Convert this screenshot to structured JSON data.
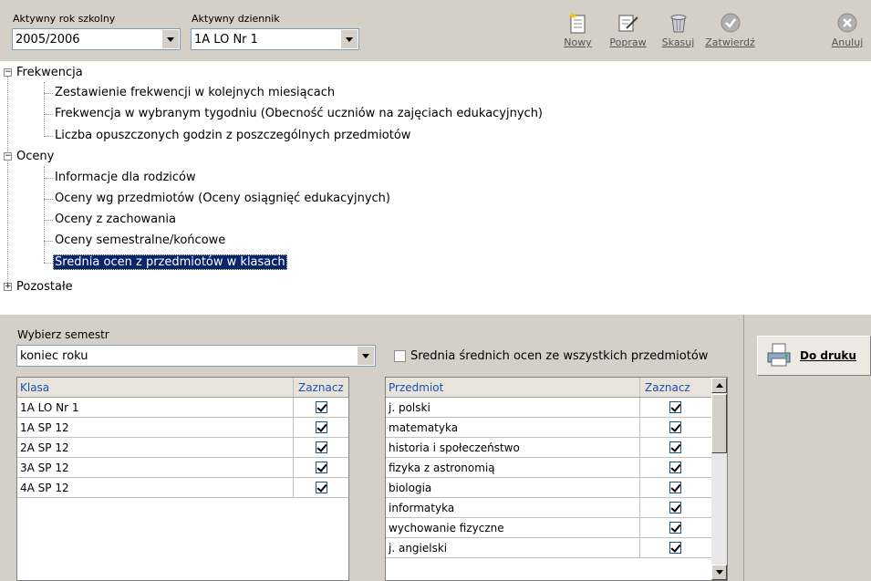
{
  "toolbar": {
    "year_label": "Aktywny rok szkolny",
    "year_value": "2005/2006",
    "journal_label": "Aktywny dziennik",
    "journal_value": "1A  LO Nr 1",
    "buttons": [
      {
        "label": "Nowy",
        "icon": "new-document-icon"
      },
      {
        "label": "Popraw",
        "icon": "edit-document-icon"
      },
      {
        "label": "Skasuj",
        "icon": "trash-icon"
      },
      {
        "label": "Zatwierdź",
        "icon": "confirm-check-icon"
      },
      {
        "label": "Anuluj",
        "icon": "cancel-x-icon"
      }
    ]
  },
  "tree": {
    "groups": [
      {
        "label": "Frekwencja",
        "expander": "−",
        "items": [
          "Zestawienie frekwencji w kolejnych miesiącach",
          "Frekwencja w wybranym tygodniu (Obecność uczniów na zajęciach edukacyjnych)",
          "Liczba opuszczonych godzin z poszczególnych przedmiotów"
        ]
      },
      {
        "label": "Oceny",
        "expander": "−",
        "items": [
          "Informacje dla rodziców",
          "Oceny wg przedmiotów (Oceny osiągnięć edukacyjnych)",
          "Oceny z zachowania",
          "Oceny semestralne/końcowe",
          "Średnia ocen z przedmiotów w klasach"
        ]
      },
      {
        "label": "Pozostałe",
        "expander": "+",
        "items": []
      }
    ],
    "selected": "Średnia ocen z przedmiotów w klasach"
  },
  "semester": {
    "label": "Wybierz semestr",
    "value": "koniec roku"
  },
  "avg_checkbox": {
    "label": "Średnia średnich ocen ze wszystkich przedmiotów",
    "checked": false
  },
  "classes_grid": {
    "headers": [
      "Klasa",
      "Zaznacz"
    ],
    "rows": [
      {
        "name": "1A  LO Nr 1",
        "checked": true
      },
      {
        "name": "1A  SP 12",
        "checked": true
      },
      {
        "name": "2A  SP 12",
        "checked": true
      },
      {
        "name": "3A  SP 12",
        "checked": true
      },
      {
        "name": "4A  SP 12",
        "checked": true
      }
    ]
  },
  "subjects_grid": {
    "headers": [
      "Przedmiot",
      "Zaznacz"
    ],
    "rows": [
      {
        "name": "j. polski",
        "checked": true
      },
      {
        "name": "matematyka",
        "checked": true
      },
      {
        "name": "historia i społeczeństwo",
        "checked": true
      },
      {
        "name": "fizyka z astronomią",
        "checked": true
      },
      {
        "name": "biologia",
        "checked": true
      },
      {
        "name": "informatyka",
        "checked": true
      },
      {
        "name": "wychowanie fizyczne",
        "checked": true
      },
      {
        "name": "j. angielski",
        "checked": true
      }
    ]
  },
  "print_button": {
    "label": "Do druku",
    "icon": "printer-icon"
  }
}
